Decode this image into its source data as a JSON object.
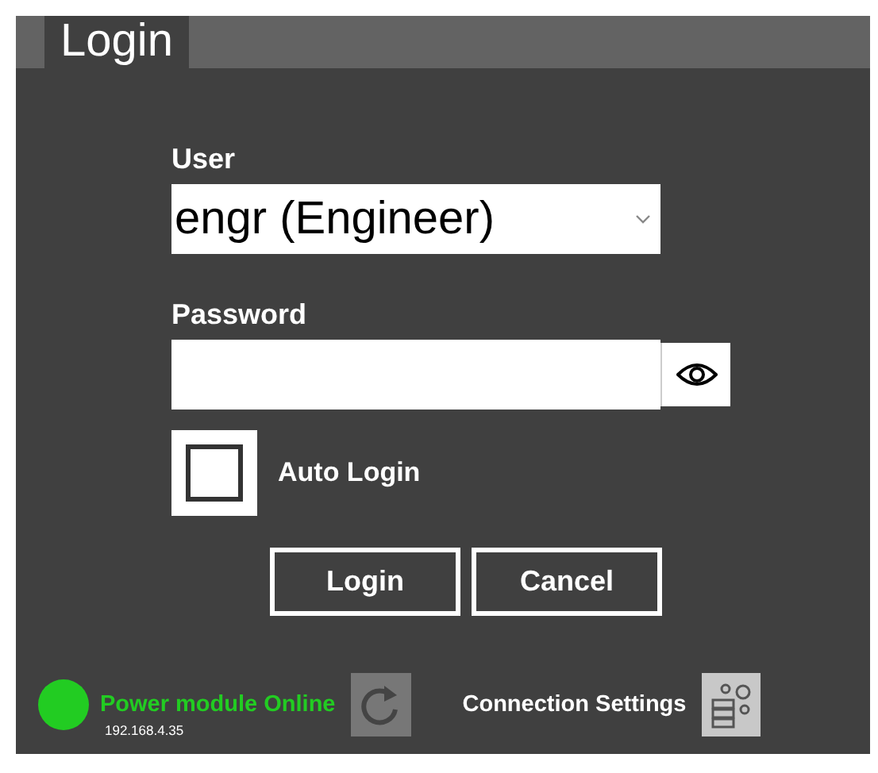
{
  "tabs": [
    {
      "label": "Login",
      "selected": true
    }
  ],
  "user": {
    "label": "User",
    "value": "engr (Engineer)"
  },
  "password": {
    "label": "Password"
  },
  "auto_login": {
    "label": "Auto Login",
    "checked": false
  },
  "buttons": [
    "Login",
    "Cancel"
  ],
  "status": {
    "text": "Power module Online",
    "address": "192.168.4.35",
    "color": "#22cc22"
  },
  "connection_settings": {
    "label": "Connection Settings"
  }
}
